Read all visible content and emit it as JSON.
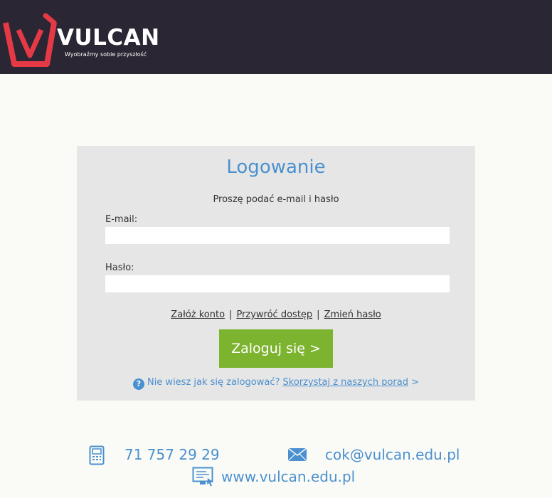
{
  "header": {
    "brand": "VULCAN",
    "tagline": "Wyobraźmy sobie przyszłość",
    "logo_color": "#e63946",
    "background": "#2a2633"
  },
  "login": {
    "title": "Logowanie",
    "subtitle": "Proszę podać e-mail i hasło",
    "email_label": "E-mail:",
    "email_value": "",
    "password_label": "Hasło:",
    "password_value": "",
    "links": {
      "create_account": "Załóż konto",
      "restore_access": "Przywróć dostęp",
      "change_password": "Zmień hasło",
      "separator": "|"
    },
    "submit_label": "Zaloguj się >",
    "help_text": "Nie wiesz jak się zalogować?",
    "help_link": "Skorzystaj z naszych porad",
    "help_arrow": ">",
    "help_icon": "?"
  },
  "contact": {
    "phone": "71 757 29 29",
    "email": "cok@vulcan.edu.pl",
    "website": "www.vulcan.edu.pl"
  },
  "colors": {
    "accent_blue": "#4b90cf",
    "button_green": "#7cb32f",
    "panel_gray": "#e6e6e6"
  }
}
